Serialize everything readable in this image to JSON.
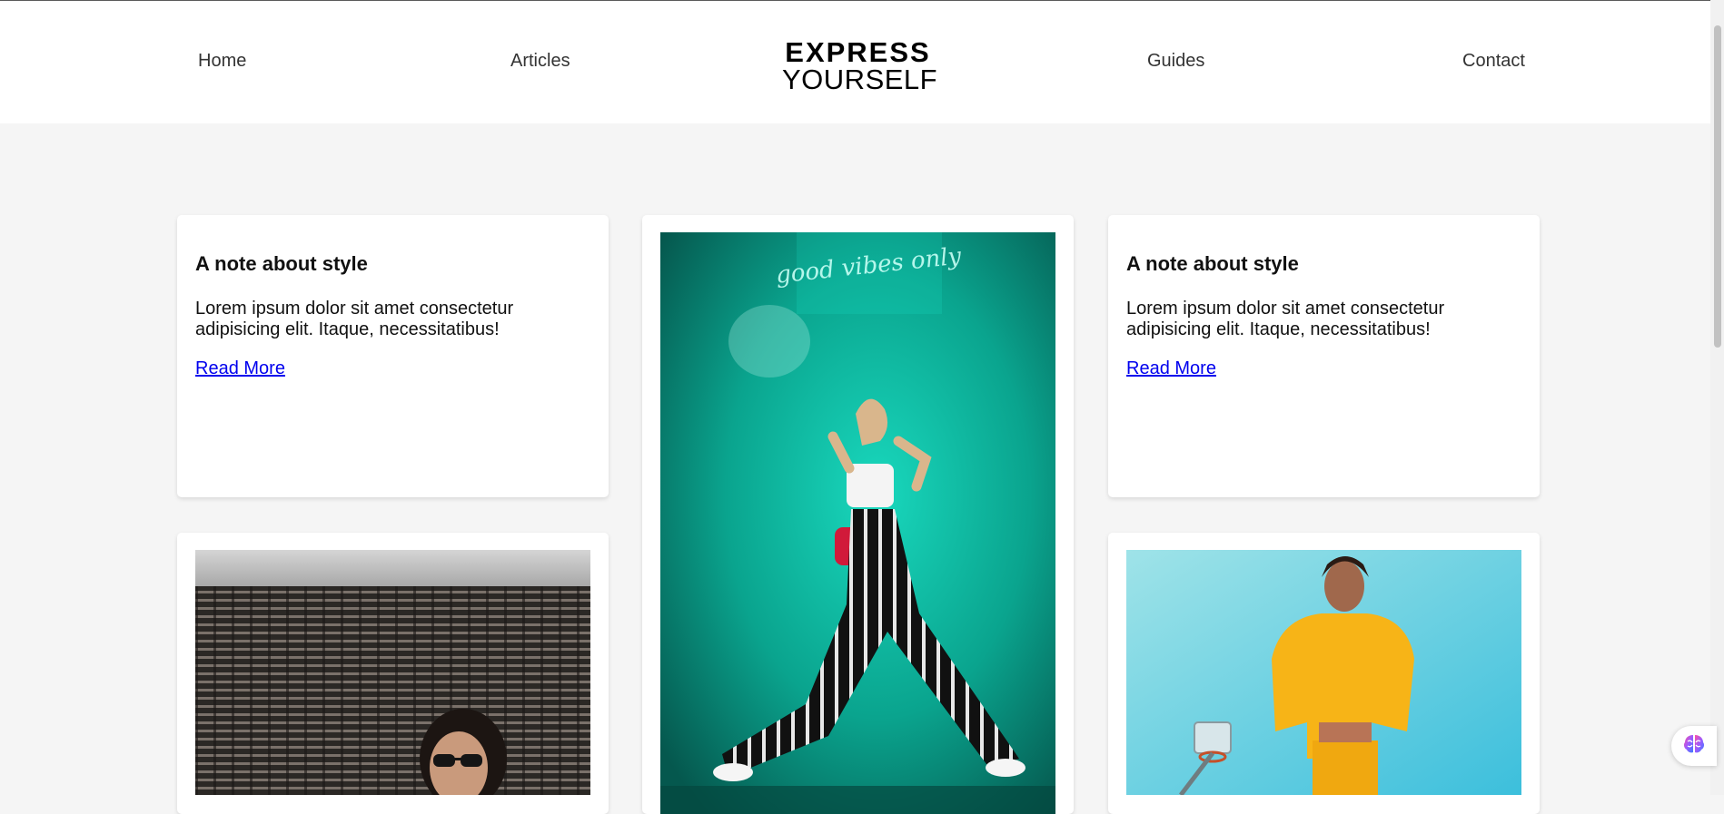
{
  "nav": {
    "home": "Home",
    "articles": "Articles",
    "guides": "Guides",
    "contact": "Contact"
  },
  "logo": {
    "line1": "EXPRESS",
    "line2": "YOURSELF"
  },
  "cards": {
    "left_text": {
      "title": "A note about style",
      "body": "Lorem ipsum dolor sit amet consectetur adipisicing elit. Itaque, necessitatibus!",
      "link": "Read More"
    },
    "right_text": {
      "title": "A note about style",
      "body": "Lorem ipsum dolor sit amet consectetur adipisicing elit. Itaque, necessitatibus!",
      "link": "Read More"
    }
  },
  "photos": {
    "center_neon_sign": "good vibes only"
  },
  "colors": {
    "page_bg": "#f5f5f5",
    "header_bg": "#ffffff",
    "link": "#0000ee",
    "teal": "#0aa48e",
    "yellow": "#f7b417",
    "sky": "#5ccde0"
  }
}
